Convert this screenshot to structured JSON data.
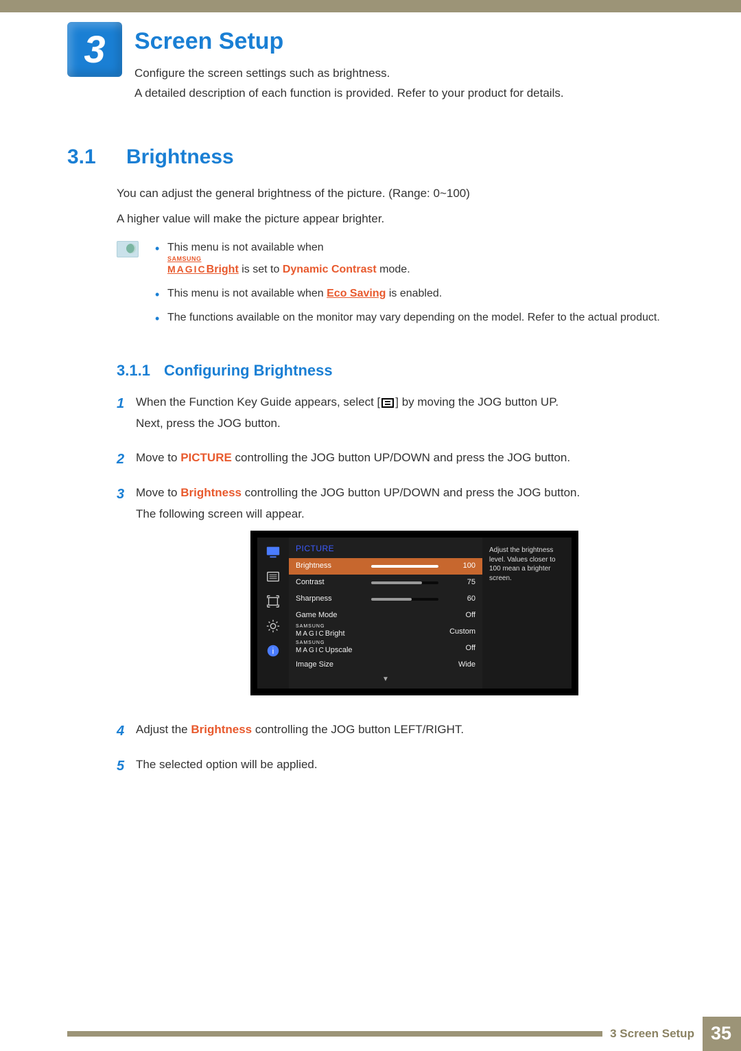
{
  "chapter": {
    "number": "3",
    "title": "Screen Setup"
  },
  "intro": {
    "line1": "Configure the screen settings such as brightness.",
    "line2": "A detailed description of each function is provided. Refer to your product for details."
  },
  "section": {
    "number": "3.1",
    "title": "Brightness",
    "range_text": "You can adjust the general brightness of the picture. (Range: 0~100)",
    "higher_text": "A higher value will make the picture appear brighter."
  },
  "notes": {
    "n1_pre": "This menu is not available when ",
    "n1_magic_sm": "SAMSUNG",
    "n1_magic_lg": "MAGIC",
    "n1_bright": "Bright",
    "n1_mid": " is set to ",
    "n1_mode": "Dynamic Contrast",
    "n1_post": " mode.",
    "n2_pre": "This menu is not available when ",
    "n2_link": "Eco Saving",
    "n2_post": " is enabled.",
    "n3": "The functions available on the monitor may vary depending on the model. Refer to the actual product."
  },
  "subsection": {
    "number": "3.1.1",
    "title": "Configuring Brightness"
  },
  "steps": {
    "s1a": "When the Function Key Guide appears, select [",
    "s1b": "] by moving the JOG button UP.",
    "s1c": "Next, press the JOG button.",
    "s2a": "Move to ",
    "s2_pic": "PICTURE",
    "s2b": " controlling the JOG button UP/DOWN and press the JOG button.",
    "s3a": "Move to ",
    "s3_b": "Brightness",
    "s3b": " controlling the JOG button UP/DOWN and press the JOG button.",
    "s3c": "The following screen will appear.",
    "s4a": "Adjust the ",
    "s4_b": "Brightness",
    "s4b": " controlling the JOG button LEFT/RIGHT.",
    "s5": "The selected option will be applied."
  },
  "osd": {
    "title": "PICTURE",
    "help": "Adjust the brightness level. Values closer to 100 mean a brighter screen.",
    "rows": [
      {
        "label": "Brightness",
        "value": "100",
        "slider": 100,
        "selected": true
      },
      {
        "label": "Contrast",
        "value": "75",
        "slider": 75,
        "selected": false
      },
      {
        "label": "Sharpness",
        "value": "60",
        "slider": 60,
        "selected": false
      },
      {
        "label": "Game Mode",
        "value": "Off",
        "slider": null,
        "selected": false
      },
      {
        "label_magic": true,
        "label": "Bright",
        "value": "Custom",
        "slider": null,
        "selected": false
      },
      {
        "label_magic": true,
        "label": "Upscale",
        "value": "Off",
        "slider": null,
        "selected": false
      },
      {
        "label": "Image Size",
        "value": "Wide",
        "slider": null,
        "selected": false
      }
    ],
    "magic_sm": "SAMSUNG",
    "magic_lg": "MAGIC"
  },
  "footer": {
    "section": "3 Screen Setup",
    "page": "35"
  }
}
